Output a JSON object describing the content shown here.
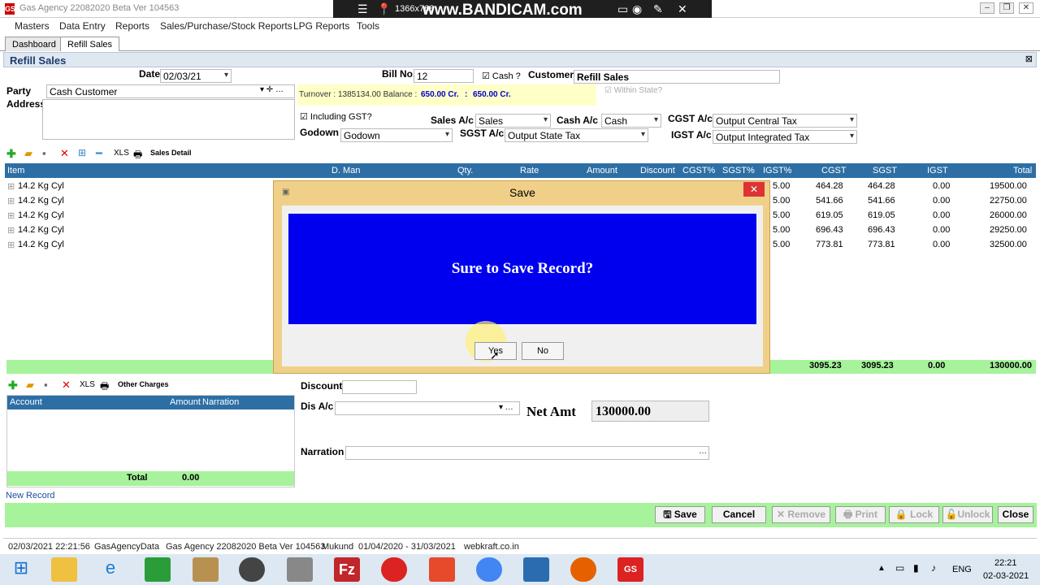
{
  "app": {
    "title": "Gas Agency 22082020 Beta Ver 104563",
    "logo_text": "GS"
  },
  "recorder": {
    "resolution": "1366x768",
    "brand": "www.BANDICAM.com"
  },
  "menu": [
    "Masters",
    "Data Entry",
    "Reports",
    "Sales/Purchase/Stock Reports",
    "LPG Reports",
    "Tools"
  ],
  "tabs": [
    "Dashboard",
    "Refill Sales"
  ],
  "form": {
    "title": "Refill Sales",
    "date_label": "Date",
    "date": "02/03/21",
    "bill_label": "Bill No.",
    "bill": "12",
    "cash_label": "Cash ?",
    "customer_label": "Customer",
    "customer": "Refill Sales",
    "within_state": "Within State?",
    "party_label": "Party",
    "party": "Cash Customer",
    "address_label": "Address",
    "turnover_label": "Turnover : 1385134.00 Balance :",
    "balance1": "650.00 Cr.",
    "balance_sep": ":",
    "balance2": "650.00 Cr.",
    "incl_gst": "Including GST?",
    "godown_label": "Godown",
    "godown": "Godown",
    "sales_ac_label": "Sales A/c",
    "sales_ac": "Sales",
    "cash_ac_label": "Cash A/c",
    "cash_ac": "Cash",
    "cgst_ac_label": "CGST A/c",
    "cgst_ac": "Output Central Tax",
    "sgst_ac_label": "SGST A/c",
    "sgst_ac": "Output State Tax",
    "igst_ac_label": "IGST A/c",
    "igst_ac": "Output Integrated Tax"
  },
  "toolbar": {
    "xls": "XLS",
    "sales_detail": "Sales Detail",
    "other_charges": "Other Charges"
  },
  "grid": {
    "columns": [
      "Item",
      "D. Man",
      "Qty.",
      "Rate",
      "Amount",
      "Discount",
      "CGST%",
      "SGST%",
      "IGST%",
      "CGST",
      "SGST",
      "IGST",
      "Total"
    ],
    "rows": [
      {
        "item": "14.2 Kg Cyl",
        "igstp": "5.00",
        "cgst": "464.28",
        "sgst": "464.28",
        "igst": "0.00",
        "total": "19500.00"
      },
      {
        "item": "14.2 Kg Cyl",
        "igstp": "5.00",
        "cgst": "541.66",
        "sgst": "541.66",
        "igst": "0.00",
        "total": "22750.00"
      },
      {
        "item": "14.2 Kg Cyl",
        "igstp": "5.00",
        "cgst": "619.05",
        "sgst": "619.05",
        "igst": "0.00",
        "total": "26000.00"
      },
      {
        "item": "14.2 Kg Cyl",
        "igstp": "5.00",
        "cgst": "696.43",
        "sgst": "696.43",
        "igst": "0.00",
        "total": "29250.00"
      },
      {
        "item": "14.2 Kg Cyl",
        "igstp": "5.00",
        "cgst": "773.81",
        "sgst": "773.81",
        "igst": "0.00",
        "total": "32500.00"
      }
    ],
    "totals": {
      "cgst": "3095.23",
      "sgst": "3095.23",
      "igst": "0.00",
      "total": "130000.00"
    }
  },
  "charges": {
    "columns": [
      "Account",
      "Amount",
      "Narration"
    ],
    "total_label": "Total",
    "total": "0.00"
  },
  "footer": {
    "discount_label": "Discount",
    "dis_ac_label": "Dis A/c",
    "net_amt_label": "Net Amt",
    "net_amt": "130000.00",
    "narration_label": "Narration",
    "new_record": "New Record"
  },
  "buttons": {
    "save": "Save",
    "cancel": "Cancel",
    "remove": "Remove",
    "print": "Print",
    "lock": "Lock",
    "unlock": "Unlock",
    "close": "Close"
  },
  "status": [
    "02/03/2021 22:21:56",
    "GasAgencyData",
    "Gas Agency 22082020 Beta Ver 104563",
    "Mukund",
    "01/04/2020 - 31/03/2021",
    "webkraft.co.in"
  ],
  "dialog": {
    "title": "Save",
    "message": "Sure to Save Record?",
    "yes": "Yes",
    "no": "No"
  },
  "taskbar": {
    "lang": "ENG",
    "time": "22:21",
    "date": "02-03-2021"
  }
}
